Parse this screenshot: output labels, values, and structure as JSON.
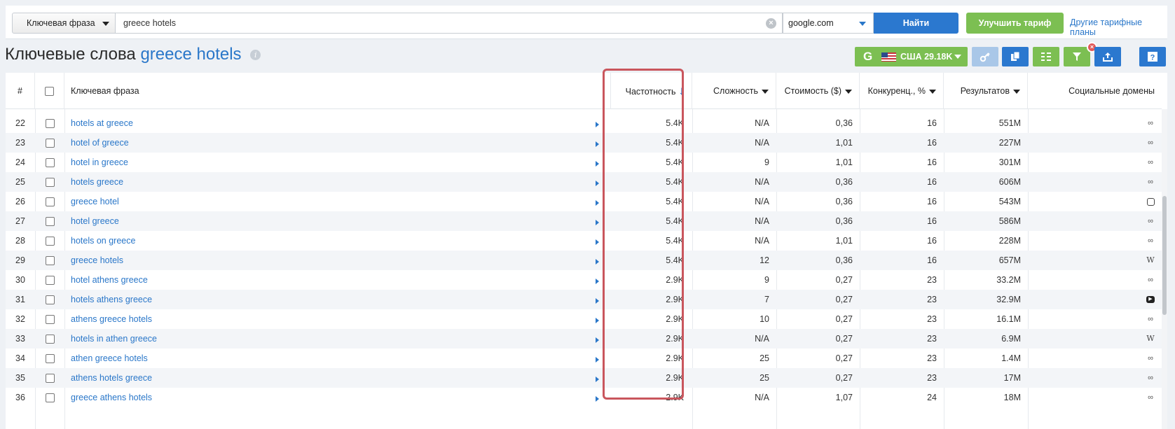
{
  "search": {
    "mode_label": "Ключевая фраза",
    "query": "greece hotels",
    "engine": "google.com",
    "find_button": "Найти",
    "upgrade_button": "Улучшить тариф",
    "other_plans_link": "Другие тарифные планы"
  },
  "heading": {
    "prefix": "Ключевые слова",
    "keyword": "greece hotels"
  },
  "toolbar": {
    "google_glyph": "G",
    "region_label": "США 29.18K",
    "icons": [
      "key-icon",
      "copy-icon",
      "columns-icon",
      "filter-icon",
      "export-icon",
      "help-icon"
    ],
    "filter_badge": "×"
  },
  "table": {
    "headers": {
      "num": "#",
      "keyword": "Ключевая фраза",
      "frequency": "Частотность",
      "difficulty": "Сложность",
      "cost": "Стоимость ($)",
      "competition": "Конкуренц., %",
      "results": "Результатов",
      "social": "Социальные домены"
    },
    "sort_arrow": "↓",
    "rows": [
      {
        "num": "22",
        "keyword": "hotels at greece",
        "freq": "5.4K",
        "diff": "N/A",
        "cost": "0,36",
        "comp": "16",
        "results": "551M",
        "social": "tripadvisor"
      },
      {
        "num": "23",
        "keyword": "hotel of greece",
        "freq": "5.4K",
        "diff": "N/A",
        "cost": "1,01",
        "comp": "16",
        "results": "227M",
        "social": "tripadvisor"
      },
      {
        "num": "24",
        "keyword": "hotel in greece",
        "freq": "5.4K",
        "diff": "9",
        "cost": "1,01",
        "comp": "16",
        "results": "301M",
        "social": "tripadvisor"
      },
      {
        "num": "25",
        "keyword": "hotels greece",
        "freq": "5.4K",
        "diff": "N/A",
        "cost": "0,36",
        "comp": "16",
        "results": "606M",
        "social": "tripadvisor"
      },
      {
        "num": "26",
        "keyword": "greece hotel",
        "freq": "5.4K",
        "diff": "N/A",
        "cost": "0,36",
        "comp": "16",
        "results": "543M",
        "social": "instagram"
      },
      {
        "num": "27",
        "keyword": "hotel greece",
        "freq": "5.4K",
        "diff": "N/A",
        "cost": "0,36",
        "comp": "16",
        "results": "586M",
        "social": "tripadvisor"
      },
      {
        "num": "28",
        "keyword": "hotels on greece",
        "freq": "5.4K",
        "diff": "N/A",
        "cost": "1,01",
        "comp": "16",
        "results": "228M",
        "social": "tripadvisor"
      },
      {
        "num": "29",
        "keyword": "greece hotels",
        "freq": "5.4K",
        "diff": "12",
        "cost": "0,36",
        "comp": "16",
        "results": "657M",
        "social": "wikipedia"
      },
      {
        "num": "30",
        "keyword": "hotel athens greece",
        "freq": "2.9K",
        "diff": "9",
        "cost": "0,27",
        "comp": "23",
        "results": "33.2M",
        "social": "tripadvisor"
      },
      {
        "num": "31",
        "keyword": "hotels athens greece",
        "freq": "2.9K",
        "diff": "7",
        "cost": "0,27",
        "comp": "23",
        "results": "32.9M",
        "social": "youtube"
      },
      {
        "num": "32",
        "keyword": "athens greece hotels",
        "freq": "2.9K",
        "diff": "10",
        "cost": "0,27",
        "comp": "23",
        "results": "16.1M",
        "social": "tripadvisor"
      },
      {
        "num": "33",
        "keyword": "hotels in athen greece",
        "freq": "2.9K",
        "diff": "N/A",
        "cost": "0,27",
        "comp": "23",
        "results": "6.9M",
        "social": "wikipedia"
      },
      {
        "num": "34",
        "keyword": "athen greece hotels",
        "freq": "2.9K",
        "diff": "25",
        "cost": "0,27",
        "comp": "23",
        "results": "1.4M",
        "social": "tripadvisor"
      },
      {
        "num": "35",
        "keyword": "athens hotels greece",
        "freq": "2.9K",
        "diff": "25",
        "cost": "0,27",
        "comp": "23",
        "results": "17M",
        "social": "tripadvisor"
      },
      {
        "num": "36",
        "keyword": "greece athens hotels",
        "freq": "2.9K",
        "diff": "N/A",
        "cost": "1,07",
        "comp": "24",
        "results": "18M",
        "social": "tripadvisor"
      }
    ]
  },
  "colors": {
    "accent_blue": "#2b78cf",
    "accent_green": "#7cbf52",
    "highlight_red": "#c9565d"
  }
}
